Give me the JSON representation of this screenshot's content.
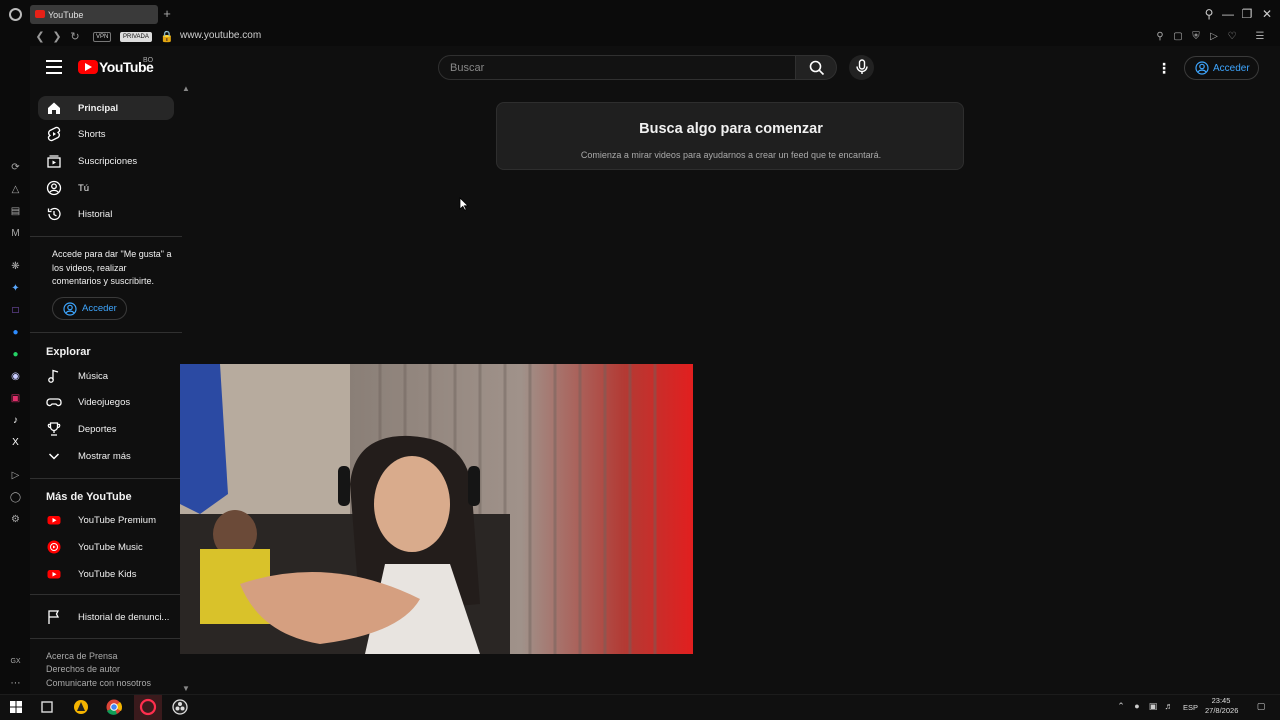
{
  "browser": {
    "tab_title": "YouTube",
    "new_tab": "+",
    "url": "www.youtube.com",
    "vpn_badge": "VPN",
    "private_badge": "PRIVADA"
  },
  "header": {
    "logo_text": "YouTube",
    "country_code": "BO",
    "search_placeholder": "Buscar",
    "signin_label": "Acceder"
  },
  "guide": {
    "main": [
      {
        "label": "Principal",
        "icon": "home-icon",
        "active": true
      },
      {
        "label": "Shorts",
        "icon": "shorts-icon"
      },
      {
        "label": "Suscripciones",
        "icon": "subscriptions-icon"
      },
      {
        "label": "Tú",
        "icon": "you-icon"
      },
      {
        "label": "Historial",
        "icon": "history-icon"
      }
    ],
    "signin_prompt": "Accede para dar \"Me gusta\" a los videos, realizar comentarios y suscribirte.",
    "signin_label": "Acceder",
    "explore_heading": "Explorar",
    "explore": [
      {
        "label": "Música",
        "icon": "music-icon"
      },
      {
        "label": "Videojuegos",
        "icon": "gaming-icon"
      },
      {
        "label": "Deportes",
        "icon": "trophy-icon"
      },
      {
        "label": "Mostrar más",
        "icon": "chevron-down-icon"
      }
    ],
    "more_heading": "Más de YouTube",
    "more": [
      {
        "label": "YouTube Premium",
        "icon": "youtube-premium-icon"
      },
      {
        "label": "YouTube Music",
        "icon": "youtube-music-icon"
      },
      {
        "label": "YouTube Kids",
        "icon": "youtube-kids-icon"
      }
    ],
    "report_history": "Historial de denunci...",
    "footer": {
      "line1": "Acerca de  Prensa",
      "line2": "Derechos de autor",
      "line3": "Comunicarte con nosotros"
    }
  },
  "main": {
    "card_title": "Busca algo para comenzar",
    "card_subtitle": "Comienza a mirar videos para ayudarnos a crear un feed que te encantará."
  },
  "taskbar": {
    "language": "ESP",
    "time": "23:45",
    "date": "27/8/2026"
  },
  "colors": {
    "background": "#0f0f0f",
    "accent_blue": "#3ea6ff",
    "youtube_red": "#ff0000"
  }
}
